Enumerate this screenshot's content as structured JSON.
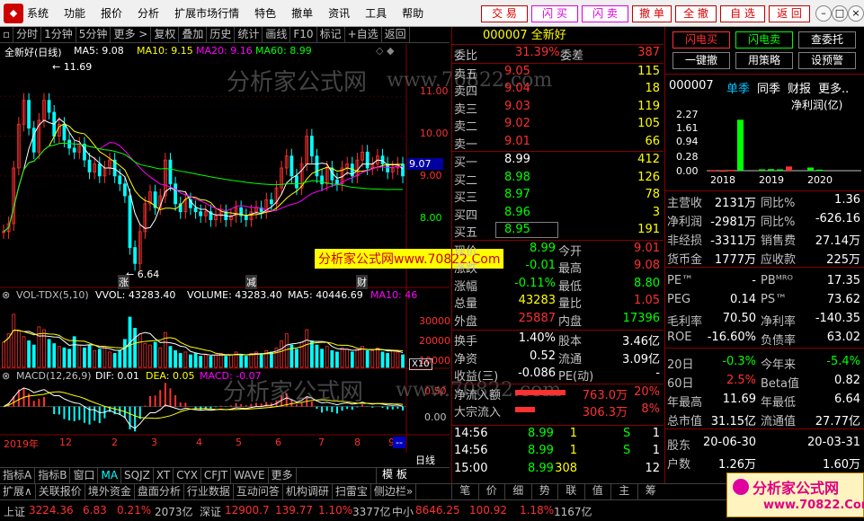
{
  "menu": {
    "items": [
      "系统",
      "功能",
      "报价",
      "分析",
      "扩展市场行情",
      "特色",
      "撤单",
      "资讯",
      "工具",
      "帮助"
    ],
    "trade_buttons": [
      "交 易",
      "闪 买",
      "闪 卖",
      "撤 单",
      "全 撤",
      "自 选",
      "返 回"
    ]
  },
  "chart_toolbar": [
    "分时",
    "1分钟",
    "5分钟",
    "更多 >",
    "复权",
    "叠加",
    "历史",
    "统计",
    "画线",
    "F10",
    "标记",
    "+自选",
    "返回"
  ],
  "chart": {
    "title": "全新好(日线)",
    "ma_legend": [
      {
        "label": "MA5: 9.08",
        "color": "#ffffff"
      },
      {
        "label": "MA10: 9.15",
        "color": "#ffff00"
      },
      {
        "label": "MA20: 9.16",
        "color": "#ff00ff"
      },
      {
        "label": "MA60: 8.99",
        "color": "#00ff00"
      }
    ],
    "price_axis": [
      "11.00",
      "10.00",
      "9.00",
      "8.00"
    ],
    "price_label": "9.07",
    "high_label": "11.69",
    "low_label": "6.64",
    "markers": [
      "涨",
      "减",
      "财"
    ],
    "vol_legend": [
      {
        "label": "VOL-TDX(5,10)",
        "color": "#c0c0c0"
      },
      {
        "label": "VVOL: 43283.40",
        "color": "#ffffff"
      },
      {
        "label": "VOLUME: 43283.40",
        "color": "#ffffff"
      },
      {
        "label": "MA5: 40446.69",
        "color": "#ffffff"
      },
      {
        "label": "MA10: 46",
        "color": "#ff00ff"
      }
    ],
    "vol_axis": [
      "30000",
      "20000",
      "10000"
    ],
    "vol_unit": "X10",
    "macd_legend": [
      {
        "label": "MACD(12,26,9)",
        "color": "#c0c0c0"
      },
      {
        "label": "DIF: 0.01",
        "color": "#ffffff"
      },
      {
        "label": "DEA: 0.05",
        "color": "#ffff00"
      },
      {
        "label": "MACD: -0.07",
        "color": "#ff00ff"
      }
    ],
    "macd_axis": [
      "0.50",
      "0.00"
    ],
    "time_axis": [
      "2019年",
      "12",
      "2",
      "3",
      "4",
      "5",
      "6",
      "7",
      "8",
      "9"
    ],
    "period_label": "日线",
    "promo_text": "分析家公式网www.70822.Com"
  },
  "chart_data": {
    "type": "line",
    "series": [
      {
        "values": [
          7.6,
          7.8,
          9.2,
          10.3,
          10.9,
          10.2,
          9.6,
          10.4,
          10.9,
          10.6,
          10.0,
          10.3,
          9.9,
          9.7,
          9.6,
          9.8,
          9.4,
          9.1,
          9.3,
          9.0,
          9.2,
          9.4,
          9.0,
          8.8,
          8.5,
          7.2,
          6.8,
          7.6,
          8.3,
          8.6,
          8.2,
          8.5,
          9.4,
          8.8,
          8.3,
          8.1,
          8.4,
          8.2,
          8.1,
          8.0,
          8.1,
          7.9,
          8.0,
          8.1,
          7.9,
          8.0,
          8.2,
          8.0,
          7.9,
          8.1,
          8.2,
          8.1,
          8.4,
          8.3,
          8.7,
          9.2,
          9.5,
          9.0,
          8.7,
          9.3,
          10.0,
          9.5,
          9.0,
          8.8,
          9.2,
          8.9,
          8.8,
          9.2,
          9.3,
          9.0,
          9.4,
          9.6,
          9.2,
          9.3,
          9.5,
          9.3,
          9.1,
          9.2,
          9.3,
          9.0
        ]
      }
    ],
    "ylim": [
      6.4,
      12.0
    ],
    "volume": [
      1.8,
      2.4,
      3.8,
      2.6,
      2.2,
      1.9,
      1.6,
      2.9,
      2.7,
      2.0,
      1.7,
      1.5,
      1.4,
      1.3,
      2.2,
      1.6,
      1.4,
      1.6,
      1.2,
      1.3,
      1.5,
      1.1,
      1.0,
      1.2,
      2.0,
      3.6,
      2.8,
      2.4,
      1.7,
      1.6,
      1.8,
      1.4,
      2.5,
      1.5,
      1.2,
      1.0,
      1.1,
      0.9,
      1.0,
      0.8,
      0.9,
      0.8,
      0.9,
      1.0,
      0.8,
      0.9,
      1.1,
      0.9,
      0.8,
      1.0,
      1.1,
      1.0,
      1.2,
      1.1,
      1.4,
      1.9,
      2.4,
      1.6,
      1.3,
      1.8,
      2.7,
      1.9,
      1.6,
      1.3,
      1.5,
      1.2,
      1.1,
      1.4,
      1.3,
      1.1,
      1.3,
      1.5,
      1.2,
      1.2,
      1.4,
      1.1,
      1.0,
      1.2,
      1.1,
      0.9
    ],
    "volume_ylim": [
      0,
      4.5
    ],
    "macd_dif": [
      0.0,
      0.1,
      0.3,
      0.5,
      0.6,
      0.55,
      0.45,
      0.5,
      0.55,
      0.45,
      0.35,
      0.35,
      0.25,
      0.18,
      0.12,
      0.1,
      0.0,
      -0.1,
      -0.1,
      -0.2,
      -0.18,
      -0.12,
      -0.2,
      -0.25,
      -0.35,
      -0.6,
      -0.7,
      -0.55,
      -0.35,
      -0.2,
      -0.2,
      -0.1,
      0.05,
      0.0,
      -0.05,
      -0.1,
      -0.05,
      -0.08,
      -0.1,
      -0.12,
      -0.1,
      -0.12,
      -0.1,
      -0.08,
      -0.1,
      -0.08,
      -0.04,
      -0.05,
      -0.06,
      -0.03,
      0.0,
      0.0,
      0.04,
      0.04,
      0.1,
      0.2,
      0.28,
      0.22,
      0.15,
      0.2,
      0.32,
      0.28,
      0.18,
      0.12,
      0.14,
      0.1,
      0.06,
      0.1,
      0.12,
      0.08,
      0.1,
      0.14,
      0.1,
      0.08,
      0.1,
      0.08,
      0.05,
      0.04,
      0.05,
      0.01
    ],
    "macd_ylim": [
      -0.85,
      0.8
    ]
  },
  "quote": {
    "code": "000007",
    "name": "全新好",
    "weibi_label": "委比",
    "weibi_value": "31.39%",
    "weicha_label": "委差",
    "weicha_value": "387",
    "sells": [
      {
        "label": "卖五",
        "price": "9.05",
        "vol": "115"
      },
      {
        "label": "卖四",
        "price": "9.04",
        "vol": "18"
      },
      {
        "label": "卖三",
        "price": "9.03",
        "vol": "119"
      },
      {
        "label": "卖二",
        "price": "9.02",
        "vol": "105"
      },
      {
        "label": "卖一",
        "price": "9.01",
        "vol": "66"
      }
    ],
    "buys": [
      {
        "label": "买一",
        "price": "8.99",
        "vol": "412"
      },
      {
        "label": "买二",
        "price": "8.98",
        "vol": "126"
      },
      {
        "label": "买三",
        "price": "8.97",
        "vol": "78"
      },
      {
        "label": "买四",
        "price": "8.96",
        "vol": "3"
      },
      {
        "label": "买五",
        "price": "8.95",
        "vol": "191"
      }
    ],
    "stats1": [
      {
        "l1": "现价",
        "v1": "8.99",
        "c1": "#00ff00",
        "l2": "今开",
        "v2": "9.01",
        "c2": "#ff3030"
      },
      {
        "l1": "涨跌",
        "v1": "-0.01",
        "c1": "#00ff00",
        "l2": "最高",
        "v2": "9.08",
        "c2": "#ff3030"
      },
      {
        "l1": "涨幅",
        "v1": "-0.11%",
        "c1": "#00ff00",
        "l2": "最低",
        "v2": "8.80",
        "c2": "#00ff00"
      },
      {
        "l1": "总量",
        "v1": "43283",
        "c1": "#ffff00",
        "l2": "量比",
        "v2": "1.05",
        "c2": "#ff3030"
      },
      {
        "l1": "外盘",
        "v1": "25887",
        "c1": "#ff3030",
        "l2": "内盘",
        "v2": "17396",
        "c2": "#00ff00"
      }
    ],
    "stats2": [
      {
        "l1": "换手",
        "v1": "1.40%",
        "l2": "股本",
        "v2": "3.46亿"
      },
      {
        "l1": "净资",
        "v1": "0.52",
        "l2": "流通",
        "v2": "3.09亿"
      },
      {
        "l1": "收益(三)",
        "v1": "-0.086",
        "l2": "PE(动)",
        "v2": "-"
      }
    ],
    "flows": [
      {
        "label": "净流入额",
        "value": "763.0万",
        "pct": "20%"
      },
      {
        "label": "大宗流入",
        "value": "306.3万",
        "pct": "8%"
      }
    ],
    "ticks": [
      {
        "time": "14:56",
        "price": "8.99",
        "vol": "1",
        "side": "S",
        "num": "1"
      },
      {
        "time": "14:56",
        "price": "8.99",
        "vol": "1",
        "side": "S",
        "num": "1"
      },
      {
        "time": "15:00",
        "price": "8.99",
        "vol": "308",
        "side": "",
        "num": "12"
      }
    ]
  },
  "right_panel": {
    "buttons": [
      "闪电买",
      "闪电卖",
      "查委托",
      "一键撤",
      "用策略",
      "设预警"
    ],
    "code": "000007",
    "tabs": [
      "单季",
      "同季",
      "财报",
      "更多.."
    ],
    "fin_title": "净利润(亿)",
    "fin_axis": [
      "2.27",
      "1.61",
      "0.94",
      "0.28",
      "0.00"
    ],
    "fin_years": [
      "2018",
      "2019",
      "2020"
    ],
    "fin_bars": [
      {
        "values": [
          0.02,
          0.01,
          0.03,
          1.95
        ],
        "colors": [
          "#ff3030",
          "#ff3030",
          "#ff3030",
          "#00ff00"
        ]
      },
      {
        "values": [
          0.05,
          0.06,
          0.05,
          0.16
        ],
        "colors": [
          "#00ff00",
          "#00ff00",
          "#00ff00",
          "#ff3030"
        ]
      },
      {
        "values": [
          0.12,
          0.04
        ],
        "colors": [
          "#00ff00",
          "#00ff00"
        ]
      }
    ],
    "fin_ylim": [
      0,
      2.27
    ],
    "fin_rows": [
      {
        "l1": "主营收",
        "v1": "2131万",
        "c1": "#ffffff",
        "l2": "同比%",
        "v2": "1.36",
        "c2": "#ffffff"
      },
      {
        "l1": "净利润",
        "v1": "-2981万",
        "c1": "#ffffff",
        "l2": "同比%",
        "v2": "-626.16",
        "c2": "#ffffff"
      },
      {
        "l1": "非经损",
        "v1": "-3311万",
        "c1": "#ffffff",
        "l2": "销售费",
        "v2": "27.14万",
        "c2": "#ffffff"
      },
      {
        "l1": "货币金",
        "v1": "1777万",
        "c1": "#ffffff",
        "l2": "应收款",
        "v2": "225万",
        "c2": "#ffffff"
      },
      {
        "l1": "",
        "v1": "",
        "c1": "#ffffff",
        "l2": "",
        "v2": "",
        "c2": "#ffffff"
      },
      {
        "l1": "PE™",
        "v1": "-",
        "c1": "#ffffff",
        "l2": "PBᴹᴿᴼ",
        "v2": "17.35",
        "c2": "#ffffff"
      },
      {
        "l1": "PEG",
        "v1": "0.14",
        "c1": "#ffffff",
        "l2": "PS™",
        "v2": "73.62",
        "c2": "#ffffff"
      },
      {
        "l1": "毛利率",
        "v1": "70.50",
        "c1": "#ffffff",
        "l2": "净利率",
        "v2": "-140.35",
        "c2": "#ffffff"
      },
      {
        "l1": "ROE",
        "v1": "-16.60%",
        "c1": "#ffffff",
        "l2": "负债率",
        "v2": "63.02",
        "c2": "#ffffff"
      },
      {
        "l1": "",
        "v1": "",
        "c1": "#ffffff",
        "l2": "",
        "v2": "",
        "c2": "#ffffff"
      },
      {
        "l1": "20日",
        "v1": "-0.3%",
        "c1": "#00ff00",
        "l2": "今年来",
        "v2": "-5.4%",
        "c2": "#00ff00"
      },
      {
        "l1": "60日",
        "v1": "2.5%",
        "c1": "#ff3030",
        "l2": "Beta值",
        "v2": "0.82",
        "c2": "#ffffff"
      },
      {
        "l1": "年最高",
        "v1": "11.69",
        "c1": "#ffffff",
        "l2": "年最低",
        "v2": "6.64",
        "c2": "#ffffff"
      },
      {
        "l1": "总市值",
        "v1": "31.15亿",
        "c1": "#ffffff",
        "l2": "流通值",
        "v2": "27.77亿",
        "c2": "#ffffff"
      },
      {
        "l1": "",
        "v1": "",
        "c1": "#ffffff",
        "l2": "",
        "v2": "",
        "c2": "#ffffff"
      },
      {
        "l1": "股东",
        "v1": "20-06-30",
        "c1": "#ffffff",
        "l2": "",
        "v2": "20-03-31",
        "c2": "#ffffff"
      },
      {
        "l1": "户数",
        "v1": "1.26万",
        "c1": "#ffffff",
        "l2": "",
        "v2": "1.60万",
        "c2": "#ffffff"
      }
    ]
  },
  "bottom_tabs": [
    "指标A",
    "指标B",
    "窗口",
    "MA",
    "SQJZ",
    "XT",
    "CYX",
    "CFJT",
    "WAVE",
    "更多"
  ],
  "bottom_tab_mode": "模 板",
  "sub_tabs": [
    "扩展∧",
    "关联报价",
    "境外资金",
    "盘面分析",
    "行业数据",
    "互动问答",
    "机构调研",
    "扫雷宝",
    "侧边栏»"
  ],
  "quote_tabs": [
    "笔",
    "价",
    "细",
    "势",
    "联",
    "值",
    "主",
    "筹"
  ],
  "status": [
    {
      "t": "上证",
      "c": "#c0c0c0"
    },
    {
      "t": "3224.36",
      "c": "#ff3030"
    },
    {
      "t": "6.83",
      "c": "#ff3030"
    },
    {
      "t": "0.21%",
      "c": "#ff3030"
    },
    {
      "t": "2073亿",
      "c": "#c0c0c0"
    },
    {
      "t": "深证",
      "c": "#c0c0c0"
    },
    {
      "t": "12900.7",
      "c": "#ff3030"
    },
    {
      "t": "139.77",
      "c": "#ff3030"
    },
    {
      "t": "1.10%",
      "c": "#ff3030"
    },
    {
      "t": "3377亿",
      "c": "#c0c0c0"
    },
    {
      "t": "中小",
      "c": "#c0c0c0"
    },
    {
      "t": "8646.25",
      "c": "#ff3030"
    },
    {
      "t": "100.92",
      "c": "#ff3030"
    },
    {
      "t": "1.18%",
      "c": "#ff3030"
    },
    {
      "t": "1167亿",
      "c": "#c0c0c0"
    }
  ],
  "watermark": [
    "分析家公式网",
    "www.70822.com"
  ],
  "brand_logo": {
    "text": "分析家公式网",
    "url": "www.70822.Com"
  }
}
